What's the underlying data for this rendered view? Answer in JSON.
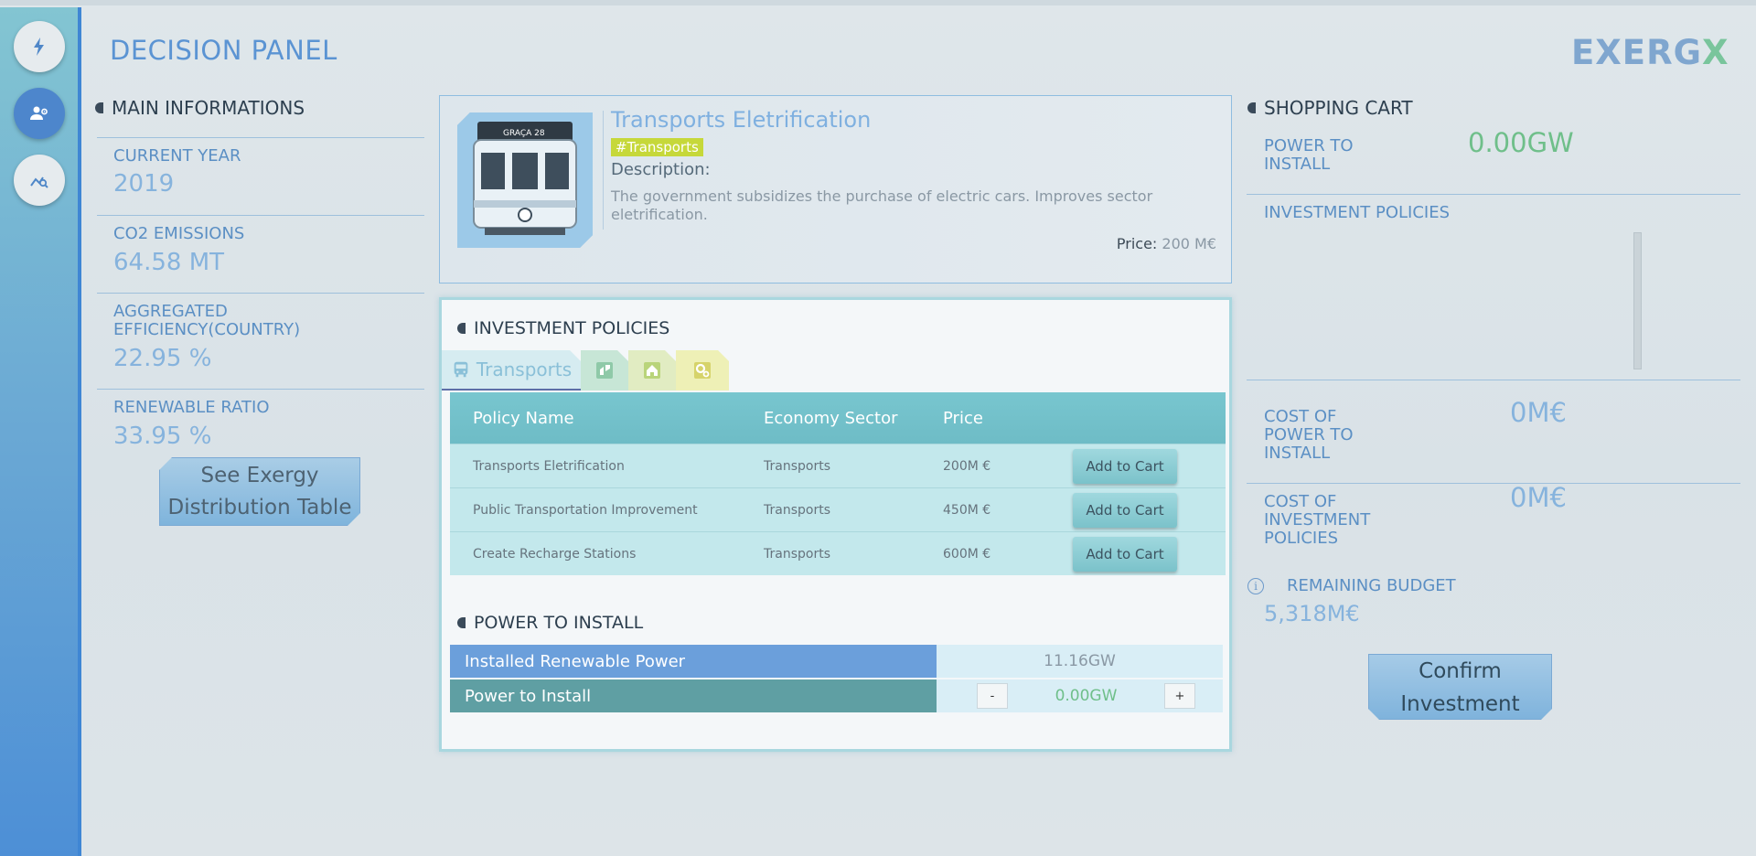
{
  "header": {
    "title": "DECISION PANEL",
    "logo": "EXERGX"
  },
  "rail": {
    "items": [
      {
        "icon": "lightning-icon"
      },
      {
        "icon": "users-gear-icon",
        "active": true
      },
      {
        "icon": "chart-search-icon"
      }
    ]
  },
  "main_info": {
    "heading": "MAIN INFORMATIONS",
    "current_year_label": "CURRENT YEAR",
    "current_year": "2019",
    "co2_label": "CO2 EMISSIONS",
    "co2_value": "64.58 MT",
    "efficiency_label_1": "AGGREGATED",
    "efficiency_label_2": "EFFICIENCY(COUNTRY)",
    "efficiency_value": "22.95 %",
    "renewable_label": "RENEWABLE RATIO",
    "renewable_value": "33.95 %",
    "exergy_button_1": "See Exergy",
    "exergy_button_2": "Distribution Table"
  },
  "policy_card": {
    "title": "Transports Eletrification",
    "tag": "#Transports",
    "description_label": "Description:",
    "description": "The government subsidizes the purchase of electric cars. Improves sector eletrification.",
    "price_label": "Price:",
    "price_value": "200 M€",
    "image_icon": "tram-icon"
  },
  "investment_policies": {
    "heading": "INVESTMENT POLICIES",
    "tabs": [
      {
        "label": "Transports",
        "icon": "bus-icon",
        "active": true
      },
      {
        "label": "",
        "icon": "industry-icon"
      },
      {
        "label": "",
        "icon": "house-icon"
      },
      {
        "label": "",
        "icon": "gears-icon"
      }
    ],
    "columns": [
      "Policy Name",
      "Economy Sector",
      "Price"
    ],
    "rows": [
      {
        "name": "Transports Eletrification",
        "sector": "Transports",
        "price": "200M €",
        "action": "Add to Cart"
      },
      {
        "name": "Public Transportation Improvement",
        "sector": "Transports",
        "price": "450M €",
        "action": "Add to Cart"
      },
      {
        "name": "Create Recharge Stations",
        "sector": "Transports",
        "price": "600M €",
        "action": "Add to Cart"
      }
    ]
  },
  "power": {
    "heading": "POWER TO INSTALL",
    "installed_label": "Installed Renewable Power",
    "installed_value": "11.16GW",
    "to_install_label": "Power to Install",
    "to_install_value": "0.00GW",
    "minus": "-",
    "plus": "+"
  },
  "cart": {
    "heading": "SHOPPING CART",
    "power_label_1": "POWER TO",
    "power_label_2": "INSTALL",
    "power_value": "0.00GW",
    "policies_label": "INVESTMENT POLICIES",
    "cost_power_label_1": "COST OF",
    "cost_power_label_2": "POWER TO",
    "cost_power_label_3": "INSTALL",
    "cost_power_value": "0M€",
    "cost_policies_label_1": "COST OF",
    "cost_policies_label_2": "INVESTMENT",
    "cost_policies_label_3": "POLICIES",
    "cost_policies_value": "0M€",
    "budget_label": "REMAINING BUDGET",
    "budget_value": "5,318M€",
    "confirm_1": "Confirm",
    "confirm_2": "Investment"
  },
  "colors": {
    "accent_blue": "#5b94d3",
    "green_value": "#6fbf8a",
    "teal_header": "#78c6cf",
    "tag_yellow": "#c6d83a"
  }
}
